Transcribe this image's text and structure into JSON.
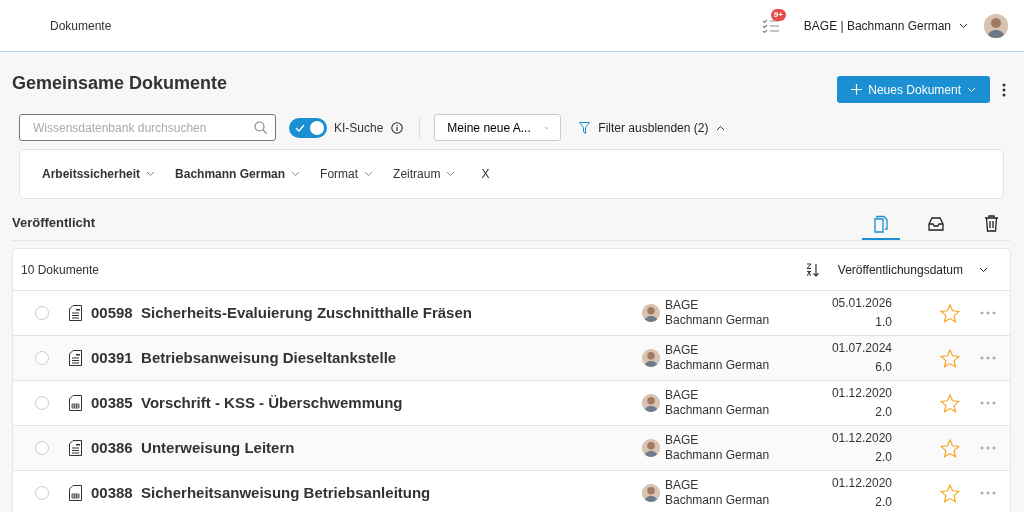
{
  "header": {
    "breadcrumb": "Dokumente",
    "notifications": {
      "badge": "9+"
    },
    "user": "BAGE | Bachmann German"
  },
  "page": {
    "title": "Gemeinsame Dokumente",
    "new_button": "Neues Dokument"
  },
  "toolbar": {
    "search": {
      "placeholder": "Wissensdatenbank durchsuchen"
    },
    "ai_toggle": {
      "label": "KI-Suche",
      "on": true
    },
    "view_select": "Meine neue A...",
    "filter_toggle": {
      "label": "Filter ausblenden (2)",
      "expanded": true
    }
  },
  "filters": [
    {
      "label": "Arbeitssicherheit",
      "active": true
    },
    {
      "label": "Bachmann German",
      "active": true
    },
    {
      "label": "Format",
      "active": false
    },
    {
      "label": "Zeitraum",
      "active": false
    }
  ],
  "clear_filters": "X",
  "section": {
    "title": "Veröffentlicht",
    "tabs": [
      {
        "kind": "published",
        "selected": true
      },
      {
        "kind": "archive",
        "selected": false
      },
      {
        "kind": "trash",
        "selected": false
      }
    ]
  },
  "list": {
    "count": "10 Dokumente",
    "sort": "Veröffentlichungsdatum",
    "rows": [
      {
        "kind": "text",
        "number": "00598",
        "title": "Sicherheits-Evaluierung Zuschnitthalle Fräsen",
        "user_code": "BAGE",
        "user_name": "Bachmann German",
        "date": "05.01.2026",
        "version": "1.0",
        "selected": false,
        "favorite": false
      },
      {
        "kind": "text",
        "number": "00391",
        "title": "Betriebsanweisung Dieseltankstelle",
        "user_code": "BAGE",
        "user_name": "Bachmann German",
        "date": "01.07.2024",
        "version": "6.0",
        "selected": false,
        "favorite": false
      },
      {
        "kind": "table",
        "number": "00385",
        "title": "Vorschrift - KSS - Überschwemmung",
        "user_code": "BAGE",
        "user_name": "Bachmann German",
        "date": "01.12.2020",
        "version": "2.0",
        "selected": false,
        "favorite": false
      },
      {
        "kind": "text",
        "number": "00386",
        "title": "Unterweisung Leitern",
        "user_code": "BAGE",
        "user_name": "Bachmann German",
        "date": "01.12.2020",
        "version": "2.0",
        "selected": false,
        "favorite": false
      },
      {
        "kind": "table",
        "number": "00388",
        "title": "Sicherheitsanweisung Betriebsanleitung",
        "user_code": "BAGE",
        "user_name": "Bachmann German",
        "date": "01.12.2020",
        "version": "2.0",
        "selected": false,
        "favorite": false
      }
    ]
  }
}
